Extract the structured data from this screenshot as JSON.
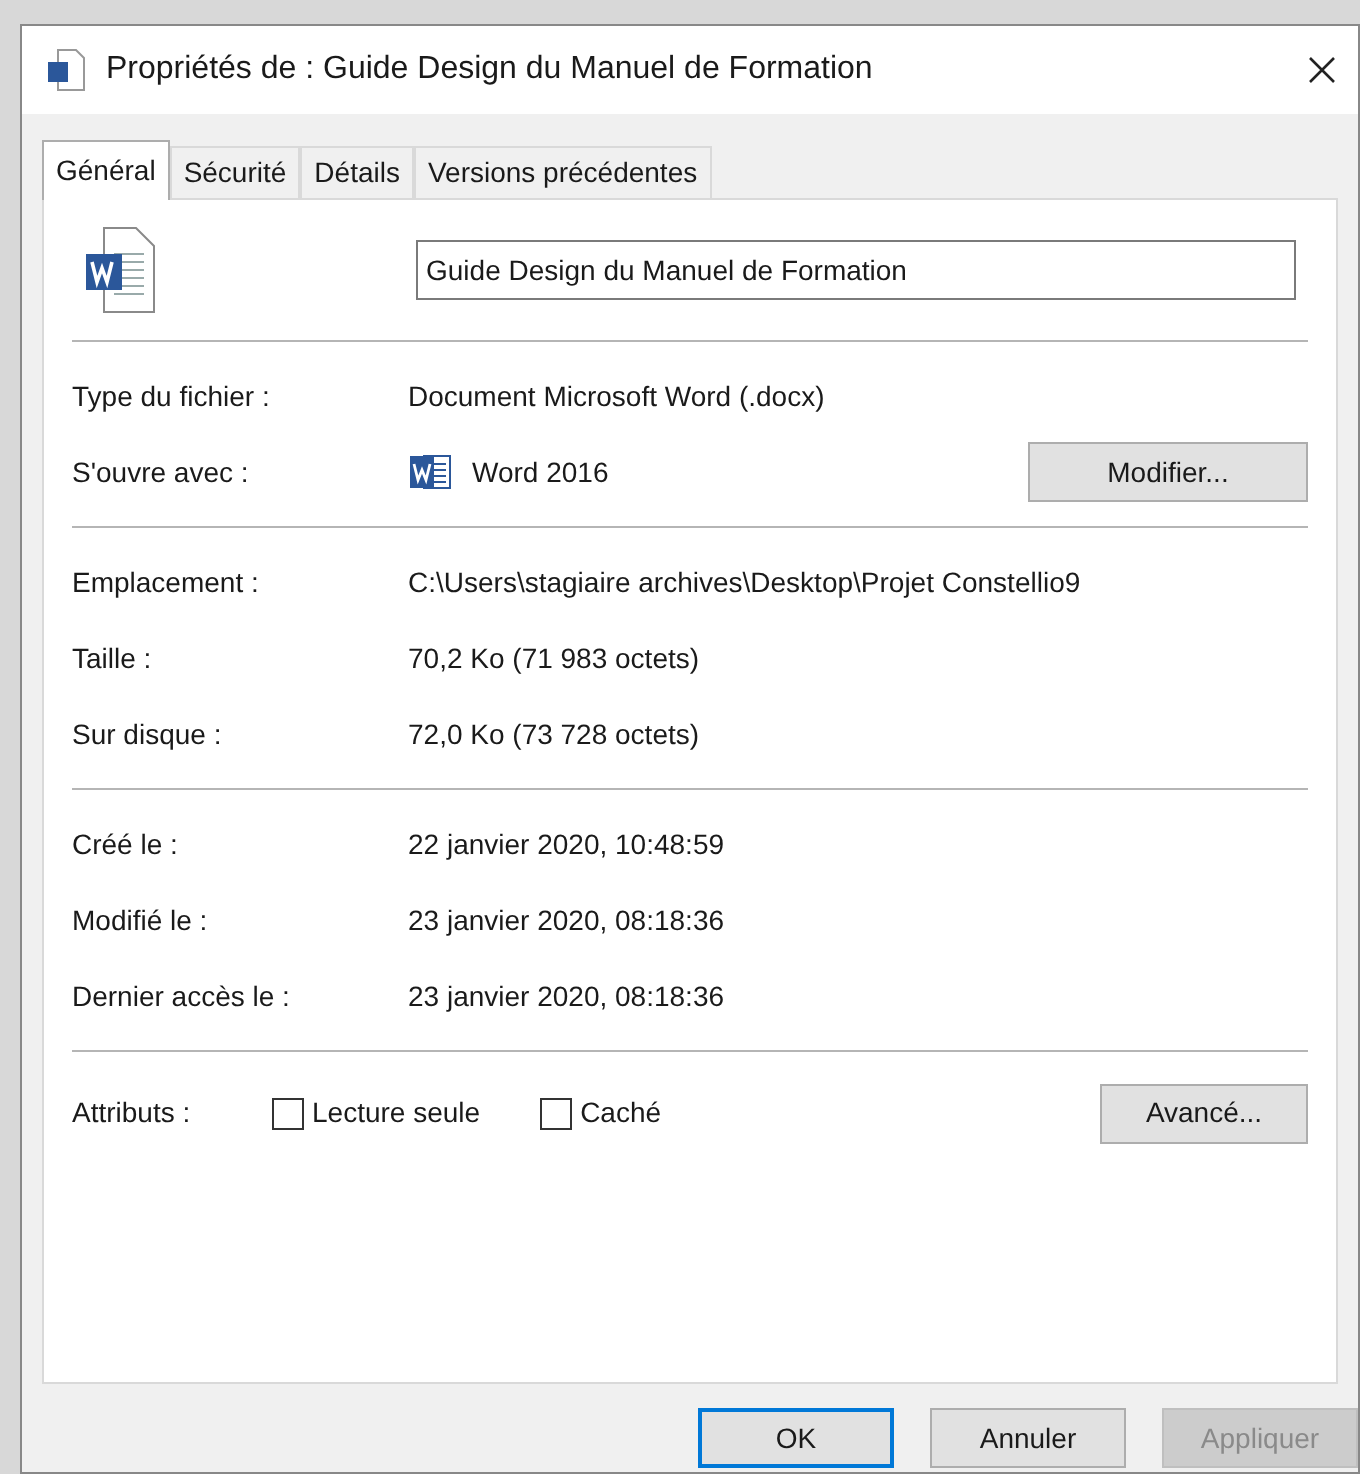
{
  "window": {
    "title": "Propriétés de : Guide Design du Manuel de Formation"
  },
  "tabs": [
    {
      "label": "Général",
      "selected": true
    },
    {
      "label": "Sécurité",
      "selected": false
    },
    {
      "label": "Détails",
      "selected": false
    },
    {
      "label": "Versions précédentes",
      "selected": false
    }
  ],
  "file_name": {
    "value": "Guide Design du Manuel de Formation"
  },
  "sections": [
    {
      "rows": [
        {
          "label": "Type du fichier :",
          "value": "Document Microsoft Word (.docx)"
        },
        {
          "label": "S'ouvre avec :",
          "value": "Word 2016",
          "kind": "app",
          "button": "Modifier..."
        }
      ]
    },
    {
      "rows": [
        {
          "label": "Emplacement :",
          "value": "C:\\Users\\stagiaire archives\\Desktop\\Projet Constellio9"
        },
        {
          "label": "Taille :",
          "value": "70,2 Ko (71 983 octets)"
        },
        {
          "label": "Sur disque :",
          "value": "72,0 Ko (73 728 octets)"
        }
      ]
    },
    {
      "rows": [
        {
          "label": "Créé le :",
          "value": "22 janvier 2020, 10:48:59"
        },
        {
          "label": "Modifié le :",
          "value": "23 janvier 2020, 08:18:36"
        },
        {
          "label": "Dernier accès le :",
          "value": "23 janvier 2020, 08:18:36"
        }
      ]
    }
  ],
  "attributes": {
    "label": "Attributs :",
    "options": [
      {
        "label": "Lecture seule",
        "checked": false
      },
      {
        "label": "Caché",
        "checked": false
      }
    ],
    "button": "Avancé..."
  },
  "buttons": [
    {
      "label": "OK",
      "default": true,
      "disabled": false
    },
    {
      "label": "Annuler",
      "default": false,
      "disabled": false
    },
    {
      "label": "Appliquer",
      "default": false,
      "disabled": true
    }
  ]
}
